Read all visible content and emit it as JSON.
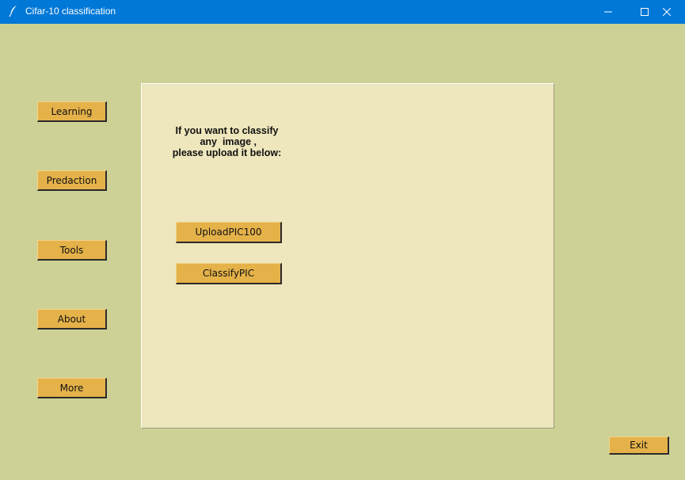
{
  "window": {
    "title": "Cifar-10 classification",
    "title_icon": "feather-icon",
    "controls": {
      "minimize_icon": "minimize-icon",
      "maximize_icon": "maximize-icon",
      "close_icon": "close-icon"
    }
  },
  "sidebar": {
    "items": [
      {
        "label": "Learning"
      },
      {
        "label": "Predaction"
      },
      {
        "label": "Tools"
      },
      {
        "label": "About"
      },
      {
        "label": "More"
      }
    ]
  },
  "panel": {
    "prompt": "If you want to classify\n any  image ,\nplease upload it below:",
    "upload_button": "UploadPIC100",
    "classify_button": "ClassifyPIC"
  },
  "footer": {
    "exit_button": "Exit"
  },
  "colors": {
    "titlebar": "#0078d7",
    "window_bg": "#cdd195",
    "panel_bg": "#eee6bc",
    "button_bg": "#e5b24a"
  }
}
